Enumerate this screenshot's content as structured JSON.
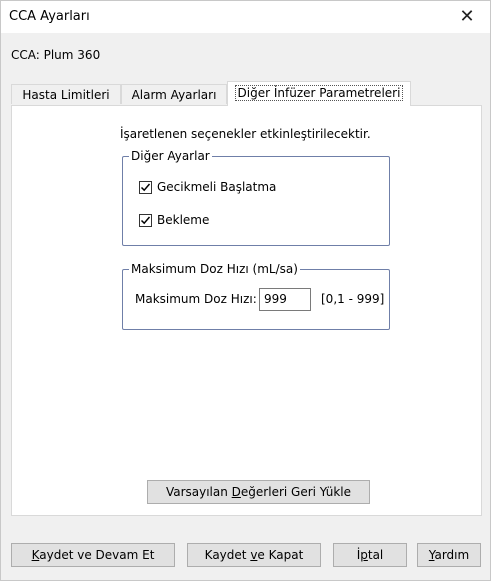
{
  "window": {
    "title": "CCA Ayarları",
    "close_glyph": "✕"
  },
  "cca_label": "CCA: Plum 360",
  "tabs": [
    {
      "label": "Hasta Limitleri"
    },
    {
      "label": "Alarm Ayarları"
    },
    {
      "label": "Diğer İnfüzer Parametreleri"
    }
  ],
  "panel": {
    "info": "İşaretlenen seçenekler etkinleştirilecektir.",
    "other_settings": {
      "legend": "Diğer Ayarlar",
      "options": [
        {
          "label": "Gecikmeli Başlatma",
          "checked": true
        },
        {
          "label": "Bekleme",
          "checked": true
        }
      ]
    },
    "max_dose": {
      "legend": "Maksimum Doz Hızı (mL/sa)",
      "field_label": "Maksimum Doz Hızı:",
      "value": "999",
      "range": "[0,1 - 999]"
    },
    "restore_button": {
      "pre": "Varsayılan ",
      "key": "D",
      "post": "eğerleri Geri Yükle"
    }
  },
  "footer": {
    "save_continue": {
      "pre": "",
      "key": "K",
      "post": "aydet ve Devam Et"
    },
    "save_close": {
      "pre": "Kaydet ",
      "key": "v",
      "post": "e Kapat"
    },
    "cancel": {
      "pre": "İ",
      "key": "p",
      "post": "tal"
    },
    "help": {
      "pre": "",
      "key": "Y",
      "post": "ardım"
    }
  }
}
